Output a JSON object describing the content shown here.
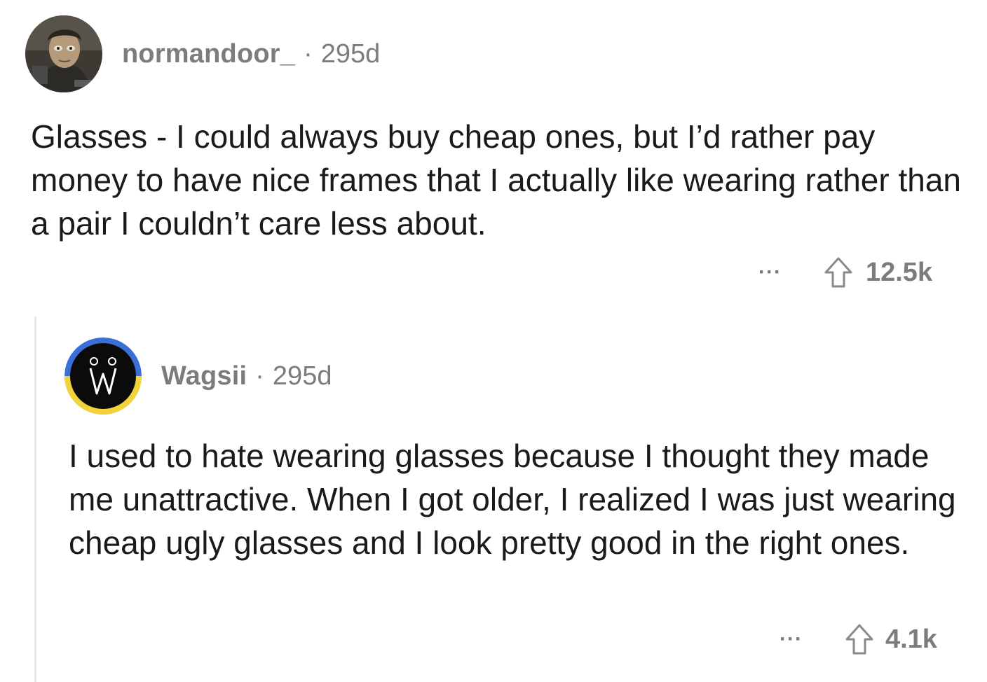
{
  "comments": [
    {
      "username": "normandoor_",
      "separator": "·",
      "age": "295d",
      "body": "Glasses - I could always buy cheap ones, but I’d rather pay money to have nice frames that I actually like wearing rather than a pair I couldn’t care less about.",
      "more_label": "···",
      "upvote_icon": "upvote-arrow-icon",
      "votes": "12.5k"
    },
    {
      "username": "Wagsii",
      "separator": "·",
      "age": "295d",
      "body": "I used to hate wearing glasses because I thought they made me unattractive. When I got older, I realized I was just wearing cheap ugly glasses and I look pretty good in the right ones.",
      "more_label": "···",
      "upvote_icon": "upvote-arrow-icon",
      "votes": "4.1k"
    }
  ],
  "colors": {
    "text": "#1a1a1b",
    "meta": "#7c7c7c",
    "thread_line": "#e6e6e6",
    "avatar2_ring_top": "#3a6fd8",
    "avatar2_ring_bottom": "#f2d43a"
  }
}
